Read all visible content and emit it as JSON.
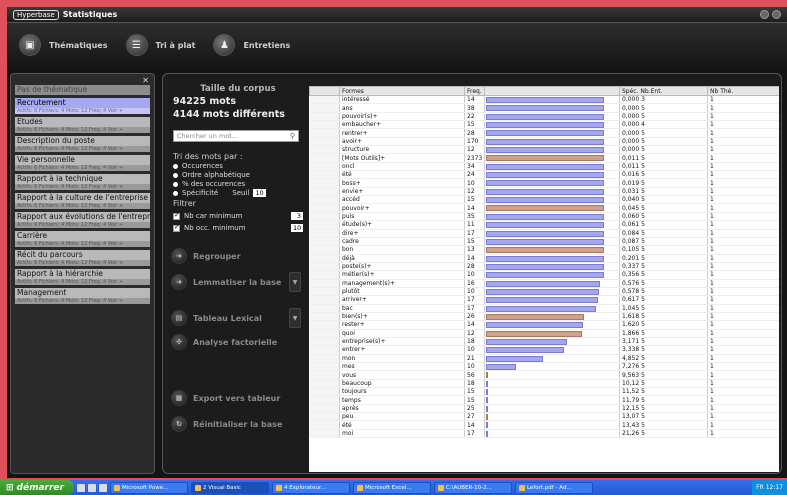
{
  "window": {
    "logo": "Hyperbase",
    "title": "Statistiques"
  },
  "toolbar": [
    {
      "label": "Thématiques",
      "icon": "cube-icon"
    },
    {
      "label": "Tri à plat",
      "icon": "list-icon"
    },
    {
      "label": "Entretiens",
      "icon": "people-icon"
    }
  ],
  "themes": [
    {
      "name": "Pas de thématique",
      "sub": "",
      "header": true
    },
    {
      "name": "Recrutement",
      "sub": "Actifs: 6   Fichiers: 4  Mots: 12 Freq: 4 Voir  +",
      "selected": true
    },
    {
      "name": "Etudes",
      "sub": "Actifs: 6   Fichiers: 4  Mots: 12 Freq: 4 Voir  +"
    },
    {
      "name": "Description du poste",
      "sub": "Actifs: 6   Fichiers: 4  Mots: 12 Freq: 4 Voir  +"
    },
    {
      "name": "Vie personnelle",
      "sub": "Actifs: 6   Fichiers: 4  Mots: 12 Freq: 4 Voir  +"
    },
    {
      "name": "Rapport à la technique",
      "sub": "Actifs: 6   Fichiers: 4  Mots: 12 Freq: 4 Voir  +"
    },
    {
      "name": "Rapport à la culture de l'entreprise",
      "sub": "Actifs: 6   Fichiers: 4  Mots: 12 Freq: 4 Voir  +"
    },
    {
      "name": "Rapport aux évolutions de l'entreprise",
      "sub": "Actifs: 6   Fichiers: 4  Mots: 12 Freq: 4 Voir  +"
    },
    {
      "name": "Carrière",
      "sub": "Actifs: 6   Fichiers: 4  Mots: 12 Freq: 4 Voir  +"
    },
    {
      "name": "Récit du parcours",
      "sub": "Actifs: 6   Fichiers: 4  Mots: 12 Freq: 4 Voir  +"
    },
    {
      "name": "Rapport à la hiérarchie",
      "sub": "Actifs: 6   Fichiers: 4  Mots: 12 Freq: 4 Voir  +"
    },
    {
      "name": "Management",
      "sub": "Actifs: 6   Fichiers: 4  Mots: 12 Freq: 4 Voir  +"
    }
  ],
  "corpus": {
    "title": "Taille du corpus",
    "words": "94225 mots",
    "distinct": "4144 mots différents",
    "search_placeholder": "Chercher un mot..."
  },
  "sort": {
    "title": "Tri des mots par :",
    "options": [
      "Occurences",
      "Ordre alphabétique",
      "% des occurences",
      "Spécificité"
    ],
    "seuil_label": "Seuil",
    "seuil_value": "10"
  },
  "filter": {
    "title": "Filtrer",
    "car_label": "Nb car minimum",
    "car_value": "3",
    "occ_label": "Nb occ. minimum",
    "occ_value": "10"
  },
  "actions": {
    "regrouper": "Regrouper",
    "lemmatiser": "Lemmatiser la base",
    "tableau": "Tableau Lexical",
    "analyse": "Analyse factorielle",
    "export": "Export vers tableur",
    "reinit": "Réinitialiser la base"
  },
  "table": {
    "headers": [
      "",
      "Formes",
      "Freq.",
      "",
      "Spéc. Nb.Ent.",
      "Nb Thé."
    ],
    "rows": [
      [
        "",
        "intéressé",
        "14",
        1.0,
        "0,000  3",
        "1"
      ],
      [
        "",
        "ans",
        "38",
        1.0,
        "0,000  5",
        "1"
      ],
      [
        "",
        "pouvoir(s)+",
        "22",
        1.0,
        "0,000  5",
        "1"
      ],
      [
        "",
        "embaucher+",
        "15",
        1.0,
        "0,000  4",
        "1"
      ],
      [
        "",
        "rentrer+",
        "28",
        1.0,
        "0,000  5",
        "1"
      ],
      [
        "",
        "avoir+",
        "170",
        1.0,
        "0,000  5",
        "1"
      ],
      [
        "",
        "structure",
        "12",
        1.0,
        "0,000  5",
        "1"
      ],
      [
        "",
        "[Mots Outils]+",
        "2373",
        1.0,
        "0,011  5",
        "1",
        "brown"
      ],
      [
        "",
        "oncl",
        "34",
        1.0,
        "0,011  5",
        "1"
      ],
      [
        "",
        "été",
        "24",
        1.0,
        "0,016  5",
        "1"
      ],
      [
        "",
        "boss+",
        "10",
        1.0,
        "0,019  5",
        "1"
      ],
      [
        "",
        "envie+",
        "12",
        1.0,
        "0,031  5",
        "1"
      ],
      [
        "",
        "accéd",
        "15",
        1.0,
        "0,040  5",
        "1"
      ],
      [
        "",
        "pouvoir+",
        "14",
        1.0,
        "0,045  5",
        "1",
        "brown"
      ],
      [
        "",
        "puis",
        "35",
        1.0,
        "0,060  5",
        "1"
      ],
      [
        "",
        "étude(s)+",
        "11",
        1.0,
        "0,061  5",
        "1"
      ],
      [
        "",
        "dire+",
        "17",
        1.0,
        "0,084  5",
        "1"
      ],
      [
        "",
        "cadre",
        "15",
        1.0,
        "0,087  5",
        "1"
      ],
      [
        "",
        "bon",
        "13",
        1.0,
        "0,105  5",
        "1",
        "brown"
      ],
      [
        "",
        "déjà",
        "14",
        1.0,
        "0,201  5",
        "1"
      ],
      [
        "",
        "poste(s)+",
        "28",
        1.0,
        "0,337  5",
        "1"
      ],
      [
        "",
        "métier(s)+",
        "10",
        1.0,
        "0,356  5",
        "1"
      ],
      [
        "",
        "management(s)+",
        "16",
        0.97,
        "0,576  5",
        "1"
      ],
      [
        "",
        "plutôt",
        "10",
        0.96,
        "0,578  5",
        "1"
      ],
      [
        "",
        "arriver+",
        "17",
        0.95,
        "0,617  5",
        "1"
      ],
      [
        "",
        "bac",
        "17",
        0.93,
        "1,045  5",
        "1"
      ],
      [
        "",
        "bien(s)+",
        "26",
        0.83,
        "1,618  5",
        "1",
        "brown"
      ],
      [
        "",
        "rester+",
        "14",
        0.82,
        "1,620  5",
        "1"
      ],
      [
        "",
        "quoi",
        "12",
        0.81,
        "1,866  5",
        "1",
        "brown"
      ],
      [
        "",
        "entreprise(s)+",
        "18",
        0.69,
        "3,171  5",
        "1"
      ],
      [
        "",
        "entrer+",
        "10",
        0.66,
        "3,338  5",
        "1"
      ],
      [
        "",
        "mon",
        "21",
        0.48,
        "4,852  5",
        "1"
      ],
      [
        "",
        "mes",
        "10",
        0.25,
        "7,276  5",
        "1"
      ],
      [
        "",
        "vous",
        "56",
        0.02,
        "9,563  5",
        "1",
        "brown"
      ],
      [
        "",
        "beaucoup",
        "18",
        0.01,
        "10,12  5",
        "1"
      ],
      [
        "",
        "toujours",
        "15",
        0.01,
        "11,52  5",
        "1"
      ],
      [
        "",
        "temps",
        "15",
        0.01,
        "11,79  5",
        "1"
      ],
      [
        "",
        "après",
        "25",
        0.01,
        "12,15  5",
        "1"
      ],
      [
        "",
        "peu",
        "27",
        0.01,
        "13,07  5",
        "1",
        "brown"
      ],
      [
        "",
        "été",
        "14",
        0.01,
        "13,43  5",
        "1"
      ],
      [
        "",
        "moi",
        "17",
        0.01,
        "21,26  5",
        "1"
      ]
    ]
  },
  "taskbar": {
    "start": "démarrer",
    "tasks": [
      "Microsoft Powe...",
      "2 Visual Basic",
      "4 Explorateur...",
      "Microsoft Excel...",
      "C:\\AUBER-10-2...",
      "Lefort.pdf - Ad..."
    ],
    "active_task": 1,
    "tray": "FR   12:17"
  },
  "colors": {
    "background": "#e0505a",
    "selected_theme": "#a6a8f2",
    "bar": "#a4a6ee",
    "bar_alt": "#d0a08c"
  }
}
